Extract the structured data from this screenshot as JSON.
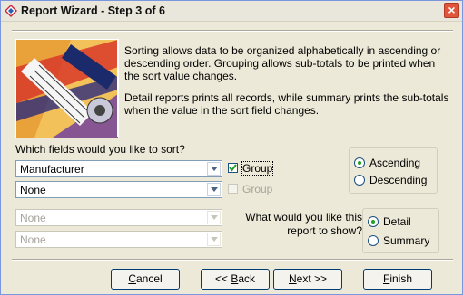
{
  "window": {
    "title": "Report Wizard - Step 3 of 6",
    "close_label": "×"
  },
  "info": {
    "paragraph1": "Sorting allows data to be organized alphabetically in ascending or descending order.  Grouping allows sub-totals to be printed when the sort value changes.",
    "paragraph2": "Detail reports prints all records, while summary prints the sub-totals when the value in the sort field changes."
  },
  "sort": {
    "prompt": "Which fields would you like to sort?",
    "fields": [
      {
        "value": "Manufacturer",
        "enabled": true,
        "group_label": "Group",
        "group_checked": true,
        "group_enabled": true
      },
      {
        "value": "None",
        "enabled": true,
        "group_label": "Group",
        "group_checked": false,
        "group_enabled": false
      },
      {
        "value": "None",
        "enabled": false
      },
      {
        "value": "None",
        "enabled": false
      }
    ]
  },
  "order": {
    "options": [
      {
        "label": "Ascending",
        "selected": true
      },
      {
        "label": "Descending",
        "selected": false
      }
    ]
  },
  "report_type": {
    "prompt_line1": "What would you like this",
    "prompt_line2": "report to show?",
    "options": [
      {
        "label": "Detail",
        "selected": true
      },
      {
        "label": "Summary",
        "selected": false
      }
    ]
  },
  "buttons": {
    "cancel": {
      "mnemonic": "C",
      "rest": "ancel"
    },
    "back": {
      "prefix": "<< ",
      "mnemonic": "B",
      "rest": "ack"
    },
    "next": {
      "mnemonic": "N",
      "rest": "ext >>"
    },
    "finish": {
      "mnemonic": "F",
      "rest": "inish"
    }
  },
  "colors": {
    "accent_check": "#21a121",
    "title_close": "#e1553b",
    "dialog_bg": "#ece9d8"
  }
}
